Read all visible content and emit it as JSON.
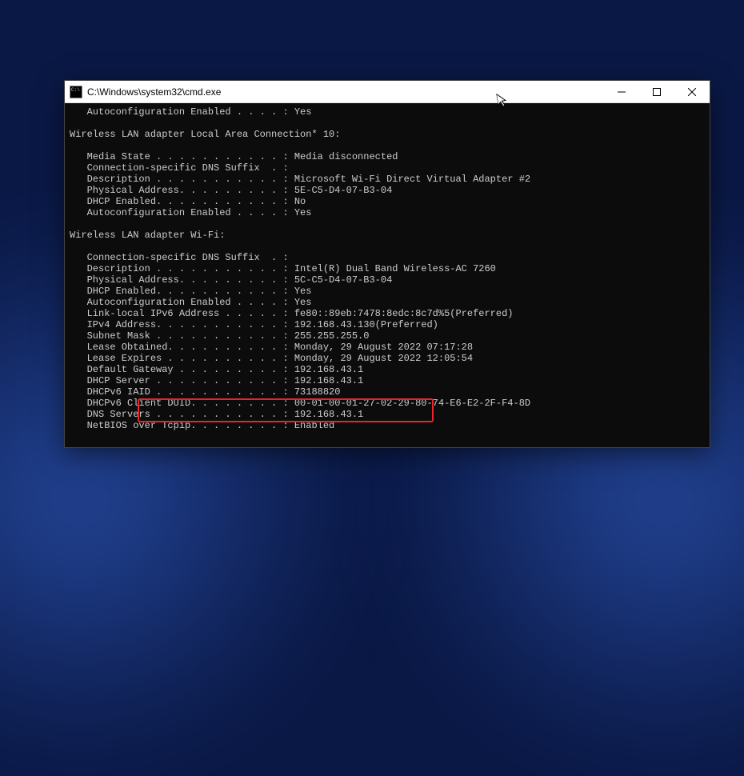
{
  "titlebar": {
    "title": "C:\\Windows\\system32\\cmd.exe"
  },
  "terminal": {
    "line01": "   Autoconfiguration Enabled . . . . : Yes",
    "blank": "",
    "section1": "Wireless LAN adapter Local Area Connection* 10:",
    "s1_media": "   Media State . . . . . . . . . . . : Media disconnected",
    "s1_dnssuf": "   Connection-specific DNS Suffix  . :",
    "s1_desc": "   Description . . . . . . . . . . . : Microsoft Wi-Fi Direct Virtual Adapter #2",
    "s1_phys": "   Physical Address. . . . . . . . . : 5E-C5-D4-07-B3-04",
    "s1_dhcp": "   DHCP Enabled. . . . . . . . . . . : No",
    "s1_auto": "   Autoconfiguration Enabled . . . . : Yes",
    "section2": "Wireless LAN adapter Wi-Fi:",
    "s2_dnssuf": "   Connection-specific DNS Suffix  . :",
    "s2_desc": "   Description . . . . . . . . . . . : Intel(R) Dual Band Wireless-AC 7260",
    "s2_phys": "   Physical Address. . . . . . . . . : 5C-C5-D4-07-B3-04",
    "s2_dhcp": "   DHCP Enabled. . . . . . . . . . . : Yes",
    "s2_auto": "   Autoconfiguration Enabled . . . . : Yes",
    "s2_link": "   Link-local IPv6 Address . . . . . : fe80::89eb:7478:8edc:8c7d%5(Preferred)",
    "s2_ipv4": "   IPv4 Address. . . . . . . . . . . : 192.168.43.130(Preferred)",
    "s2_mask": "   Subnet Mask . . . . . . . . . . . : 255.255.255.0",
    "s2_lobt": "   Lease Obtained. . . . . . . . . . : Monday, 29 August 2022 07:17:28",
    "s2_lexp": "   Lease Expires . . . . . . . . . . : Monday, 29 August 2022 12:05:54",
    "s2_gw": "   Default Gateway . . . . . . . . . : 192.168.43.1",
    "s2_dhcpsrv": "   DHCP Server . . . . . . . . . . . : 192.168.43.1",
    "s2_iaid": "   DHCPv6 IAID . . . . . . . . . . . : 73188820",
    "s2_duid": "   DHCPv6 Client DUID. . . . . . . . : 00-01-00-01-27-02-29-80-74-E6-E2-2F-F4-8D",
    "s2_dns": "   DNS Servers . . . . . . . . . . . : 192.168.43.1",
    "s2_nbt": "   NetBIOS over Tcpip. . . . . . . . : Enabled"
  },
  "highlight": {
    "color": "#e8252a"
  }
}
